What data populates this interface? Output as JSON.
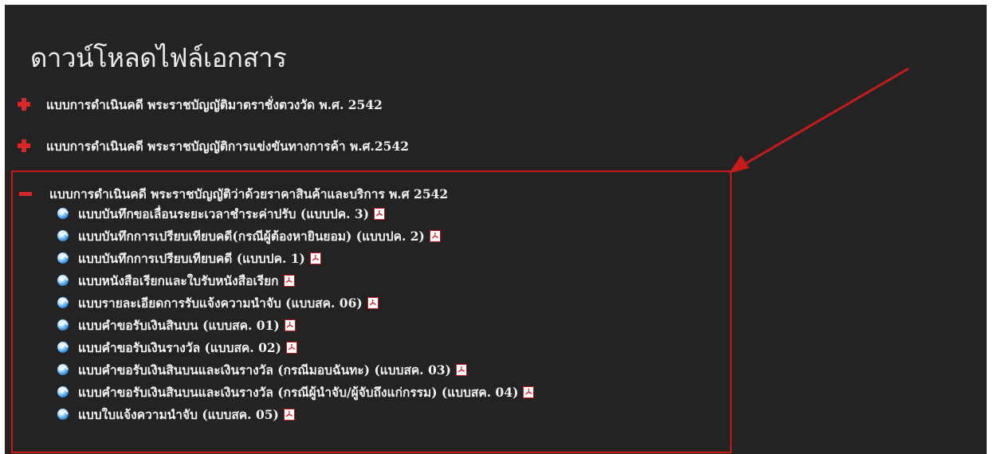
{
  "page": {
    "title": "ดาวน์โหลดไฟล์เอกสาร"
  },
  "categories": [
    {
      "label": "แบบการดำเนินคดี พระราชบัญญัติมาตราชั่งตวงวัด พ.ศ. 2542",
      "state": "collapsed"
    },
    {
      "label": "แบบการดำเนินคดี พระราชบัญญัติการแข่งขันทางการค้า พ.ศ.2542",
      "state": "collapsed"
    },
    {
      "label": "แบบการดำเนินคดี พระราชบัญญัติว่าด้วยราคาสินค้าและบริการ พ.ศ 2542",
      "state": "expanded"
    }
  ],
  "documents": [
    {
      "label": "แบบบันทึกขอเลื่อนระยะเวลาชำระค่าปรับ (แบบปค. 3)",
      "icon": "pdf-icon"
    },
    {
      "label": "แบบบันทึกการเปรียบเทียบคดี(กรณีผู้ต้องหายินยอม) (แบบปค. 2)",
      "icon": "pdf-icon"
    },
    {
      "label": "แบบบันทึกการเปรียบเทียบคดี (แบบปค. 1)",
      "icon": "pdf-icon"
    },
    {
      "label": "แบบหนังสือเรียกและใบรับหนังสือเรียก",
      "icon": "pdf-icon"
    },
    {
      "label": "แบบรายละเอียดการรับแจ้งความนำจับ (แบบสค. 06)",
      "icon": "pdf-icon"
    },
    {
      "label": "แบบคำขอรับเงินสินบน (แบบสค. 01)",
      "icon": "pdf-icon"
    },
    {
      "label": "แบบคำขอรับเงินรางวัล (แบบสค. 02)",
      "icon": "pdf-icon"
    },
    {
      "label": "แบบคำขอรับเงินสินบนและเงินรางวัล (กรณีมอบฉันทะ) (แบบสค. 03)",
      "icon": "pdf-icon"
    },
    {
      "label": "แบบคำขอรับเงินสินบนและเงินรางวัล (กรณีผู้นำจับ/ผู้จับถึงแก่กรรม) (แบบสค. 04)",
      "icon": "pdf-icon"
    },
    {
      "label": "แบบใบแจ้งความนำจับ (แบบสค. 05)",
      "icon": "pdf-icon"
    }
  ],
  "colors": {
    "background": "#232323",
    "text": "#f2f2f2",
    "accent_red": "#d9262b",
    "annotation_red": "#c71a1a"
  }
}
